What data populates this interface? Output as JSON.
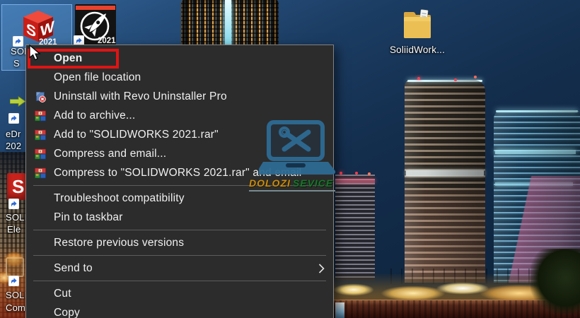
{
  "context_menu": {
    "items": [
      {
        "label": "Open",
        "icon": "none",
        "bold": true
      },
      {
        "label": "Open file location",
        "icon": "none"
      },
      {
        "label": "Uninstall with Revo Uninstaller Pro",
        "icon": "revo-uninstaller-icon"
      },
      {
        "label": "Add to archive...",
        "icon": "winrar-icon"
      },
      {
        "label": "Add to \"SOLIDWORKS 2021.rar\"",
        "icon": "winrar-icon"
      },
      {
        "label": "Compress and email...",
        "icon": "winrar-icon"
      },
      {
        "label": "Compress to \"SOLIDWORKS 2021.rar\" and email",
        "icon": "winrar-icon"
      },
      {
        "label": "Troubleshoot compatibility",
        "icon": "none"
      },
      {
        "label": "Pin to taskbar",
        "icon": "none"
      },
      {
        "label": "Restore previous versions",
        "icon": "none"
      },
      {
        "label": "Send to",
        "icon": "none",
        "submenu": true
      },
      {
        "label": "Cut",
        "icon": "none"
      },
      {
        "label": "Copy",
        "icon": "none"
      }
    ]
  },
  "desktop_icons": {
    "solidworks": {
      "label_line1": "SOLI",
      "label_line2": "S",
      "letter_s": "S",
      "letter_w": "W",
      "year": "2021",
      "selected": true
    },
    "edrawings": {
      "year": "2021"
    },
    "folder": {
      "label": "SoliidWork..."
    },
    "partials": [
      {
        "line1": "eDr",
        "line2": "202"
      },
      {
        "line1": "SOLI",
        "line2": "Ele"
      },
      {
        "line1": "SOLI",
        "line2": "Com"
      }
    ]
  },
  "watermark": {
    "word1": "DOLOZI",
    "word2": "SEVICE",
    "logo": "laptop-repair-icon"
  },
  "annotation": {
    "highlight_target": "Open",
    "color": "#df1414"
  },
  "colors": {
    "menu_bg": "#2c2c2c",
    "menu_text": "#f0f0f0",
    "selection_blue": "rgba(98,160,222,0.38)",
    "sky_top": "#34689e",
    "sky_bottom": "#0d2238"
  }
}
